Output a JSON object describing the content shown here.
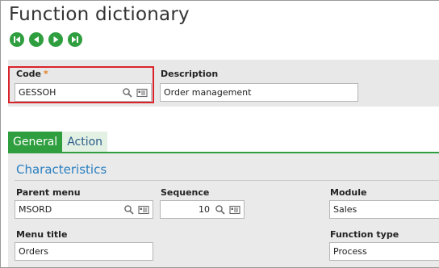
{
  "page": {
    "title": "Function dictionary"
  },
  "nav": {
    "first": "first-record-icon",
    "previous": "previous-record-icon",
    "next": "next-record-icon",
    "last": "last-record-icon"
  },
  "header": {
    "code": {
      "label": "Code",
      "required_mark": "*",
      "value": "GESSOH"
    },
    "description": {
      "label": "Description",
      "value": "Order management"
    }
  },
  "tabs": [
    {
      "label": "General",
      "active": true
    },
    {
      "label": "Action",
      "active": false
    }
  ],
  "characteristics": {
    "title": "Characteristics",
    "parent_menu": {
      "label": "Parent menu",
      "value": "MSORD"
    },
    "sequence": {
      "label": "Sequence",
      "value": "10"
    },
    "module": {
      "label": "Module",
      "value": "Sales"
    },
    "menu_title": {
      "label": "Menu title",
      "value": "Orders"
    },
    "function_type": {
      "label": "Function type",
      "value": "Process"
    }
  },
  "colors": {
    "accent_green": "#2e9e3e",
    "highlight_red": "#d9232a",
    "section_blue": "#2a7fc0",
    "required_orange": "#e67e22"
  }
}
